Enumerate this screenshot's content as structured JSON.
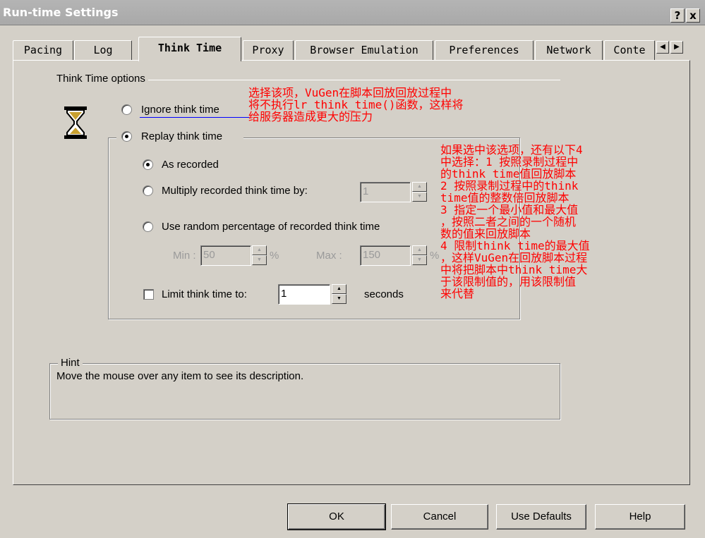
{
  "window": {
    "title": "Run-time Settings",
    "help_btn": "?",
    "close_btn": "x"
  },
  "tabs": [
    {
      "label": "Pacing"
    },
    {
      "label": "Log"
    },
    {
      "label": "Think Time"
    },
    {
      "label": "Proxy"
    },
    {
      "label": "Browser Emulation"
    },
    {
      "label": "Preferences"
    },
    {
      "label": "Network"
    },
    {
      "label": "Conte"
    }
  ],
  "tab_scroll": {
    "left": "◀",
    "right": "▶"
  },
  "think_time_group": {
    "label": "Think Time options",
    "ignore_label": "Ignore think time",
    "replay_label": "Replay think time",
    "as_recorded_label": "As recorded",
    "multiply_label": "Multiply recorded think time by:",
    "multiply_value": "1",
    "random_label": "Use random percentage of recorded think time",
    "min_label": "Min :",
    "min_value": "50",
    "percent1": "%",
    "max_label": "Max :",
    "max_value": "150",
    "percent2": "%",
    "limit_label": "Limit think time to:",
    "limit_value": "1",
    "seconds_label": "seconds",
    "selected_mode": "replay",
    "selected_replay_option": "as_recorded"
  },
  "hint": {
    "label": "Hint",
    "text": "Move the mouse over any item to see its description."
  },
  "annotations": {
    "note1": "选择该项，VuGen在脚本回放回放过程中\n将不执行lr_think_time()函数，这样将\n给服务器造成更大的压力",
    "note2": "如果选中该选项，还有以下4\n中选择：1 按照录制过程中\n的think time值回放脚本\n2 按照录制过程中的think\ntime值的整数倍回放脚本\n3 指定一个最小值和最大值\n，按照二者之间的一个随机\n数的值来回放脚本\n4 限制think time的最大值\n，这样VuGen在回放脚本过程\n中将把脚本中think time大\n于该限制值的，用该限制值\n来代替",
    "color": "#ff0000"
  },
  "buttons": {
    "ok": "OK",
    "cancel": "Cancel",
    "use_defaults": "Use Defaults",
    "help": "Help"
  },
  "colors": {
    "face": "#d4d0c8",
    "titlebar": "#a9a9a9",
    "annotation": "#ff0000",
    "underline_line": "#0000ff"
  }
}
